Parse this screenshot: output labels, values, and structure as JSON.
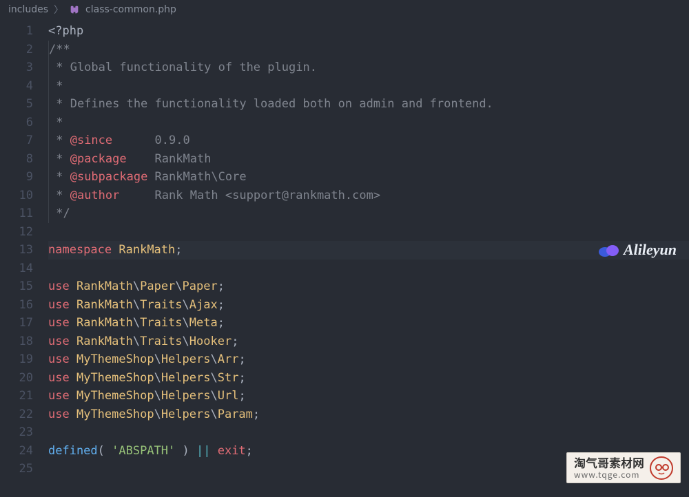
{
  "breadcrumb": {
    "folder": "includes",
    "file": "class-common.php"
  },
  "code": {
    "lines": [
      {
        "n": 1,
        "segs": [
          [
            "",
            "<?php",
            "t-php"
          ]
        ]
      },
      {
        "n": 2,
        "segs": [
          [
            "",
            "/**",
            "t-comment"
          ]
        ],
        "bl": true
      },
      {
        "n": 3,
        "segs": [
          [
            "",
            " * Global functionality of the plugin.",
            "t-comment"
          ]
        ],
        "bl": true
      },
      {
        "n": 4,
        "segs": [
          [
            "",
            " *",
            "t-comment"
          ]
        ],
        "bl": true
      },
      {
        "n": 5,
        "segs": [
          [
            "",
            " * Defines the functionality loaded both on admin and frontend.",
            "t-comment"
          ]
        ],
        "bl": true
      },
      {
        "n": 6,
        "segs": [
          [
            "",
            " *",
            "t-comment"
          ]
        ],
        "bl": true
      },
      {
        "n": 7,
        "segs": [
          [
            "",
            " * ",
            "t-comment"
          ],
          [
            "",
            "@since",
            "t-tag"
          ],
          [
            "",
            "      0.9.0",
            "t-comment"
          ]
        ],
        "bl": true
      },
      {
        "n": 8,
        "segs": [
          [
            "",
            " * ",
            "t-comment"
          ],
          [
            "",
            "@package",
            "t-tag"
          ],
          [
            "",
            "    RankMath",
            "t-comment"
          ]
        ],
        "bl": true
      },
      {
        "n": 9,
        "segs": [
          [
            "",
            " * ",
            "t-comment"
          ],
          [
            "",
            "@subpackage",
            "t-tag"
          ],
          [
            "",
            " RankMath\\Core",
            "t-comment"
          ]
        ],
        "bl": true
      },
      {
        "n": 10,
        "segs": [
          [
            "",
            " * ",
            "t-comment"
          ],
          [
            "",
            "@author",
            "t-tag"
          ],
          [
            "",
            "     Rank Math <support@rankmath.com>",
            "t-comment"
          ]
        ],
        "bl": true
      },
      {
        "n": 11,
        "segs": [
          [
            "",
            " */",
            "t-comment"
          ]
        ],
        "bl": true
      },
      {
        "n": 12,
        "segs": [
          [
            "",
            "",
            ""
          ]
        ]
      },
      {
        "n": 13,
        "hl": true,
        "segs": [
          [
            "",
            "namespace",
            "t-red"
          ],
          [
            "",
            " ",
            ""
          ],
          [
            "",
            "RankMath",
            "t-ns"
          ],
          [
            "",
            ";",
            "t-punct"
          ]
        ]
      },
      {
        "n": 14,
        "segs": [
          [
            "",
            "",
            ""
          ]
        ]
      },
      {
        "n": 15,
        "segs": [
          [
            "",
            "use",
            "t-red"
          ],
          [
            "",
            " ",
            ""
          ],
          [
            "",
            "RankMath",
            "t-ns"
          ],
          [
            "",
            "\\",
            "t-punct"
          ],
          [
            "",
            "Paper",
            "t-ns"
          ],
          [
            "",
            "\\",
            "t-punct"
          ],
          [
            "",
            "Paper",
            "t-ns"
          ],
          [
            "",
            ";",
            "t-punct"
          ]
        ]
      },
      {
        "n": 16,
        "segs": [
          [
            "",
            "use",
            "t-red"
          ],
          [
            "",
            " ",
            ""
          ],
          [
            "",
            "RankMath",
            "t-ns"
          ],
          [
            "",
            "\\",
            "t-punct"
          ],
          [
            "",
            "Traits",
            "t-ns"
          ],
          [
            "",
            "\\",
            "t-punct"
          ],
          [
            "",
            "Ajax",
            "t-ns"
          ],
          [
            "",
            ";",
            "t-punct"
          ]
        ]
      },
      {
        "n": 17,
        "segs": [
          [
            "",
            "use",
            "t-red"
          ],
          [
            "",
            " ",
            ""
          ],
          [
            "",
            "RankMath",
            "t-ns"
          ],
          [
            "",
            "\\",
            "t-punct"
          ],
          [
            "",
            "Traits",
            "t-ns"
          ],
          [
            "",
            "\\",
            "t-punct"
          ],
          [
            "",
            "Meta",
            "t-ns"
          ],
          [
            "",
            ";",
            "t-punct"
          ]
        ]
      },
      {
        "n": 18,
        "segs": [
          [
            "",
            "use",
            "t-red"
          ],
          [
            "",
            " ",
            ""
          ],
          [
            "",
            "RankMath",
            "t-ns"
          ],
          [
            "",
            "\\",
            "t-punct"
          ],
          [
            "",
            "Traits",
            "t-ns"
          ],
          [
            "",
            "\\",
            "t-punct"
          ],
          [
            "",
            "Hooker",
            "t-ns"
          ],
          [
            "",
            ";",
            "t-punct"
          ]
        ]
      },
      {
        "n": 19,
        "segs": [
          [
            "",
            "use",
            "t-red"
          ],
          [
            "",
            " ",
            ""
          ],
          [
            "",
            "MyThemeShop",
            "t-ns"
          ],
          [
            "",
            "\\",
            "t-punct"
          ],
          [
            "",
            "Helpers",
            "t-ns"
          ],
          [
            "",
            "\\",
            "t-punct"
          ],
          [
            "",
            "Arr",
            "t-ns"
          ],
          [
            "",
            ";",
            "t-punct"
          ]
        ]
      },
      {
        "n": 20,
        "segs": [
          [
            "",
            "use",
            "t-red"
          ],
          [
            "",
            " ",
            ""
          ],
          [
            "",
            "MyThemeShop",
            "t-ns"
          ],
          [
            "",
            "\\",
            "t-punct"
          ],
          [
            "",
            "Helpers",
            "t-ns"
          ],
          [
            "",
            "\\",
            "t-punct"
          ],
          [
            "",
            "Str",
            "t-ns"
          ],
          [
            "",
            ";",
            "t-punct"
          ]
        ]
      },
      {
        "n": 21,
        "segs": [
          [
            "",
            "use",
            "t-red"
          ],
          [
            "",
            " ",
            ""
          ],
          [
            "",
            "MyThemeShop",
            "t-ns"
          ],
          [
            "",
            "\\",
            "t-punct"
          ],
          [
            "",
            "Helpers",
            "t-ns"
          ],
          [
            "",
            "\\",
            "t-punct"
          ],
          [
            "",
            "Url",
            "t-ns"
          ],
          [
            "",
            ";",
            "t-punct"
          ]
        ]
      },
      {
        "n": 22,
        "segs": [
          [
            "",
            "use",
            "t-red"
          ],
          [
            "",
            " ",
            ""
          ],
          [
            "",
            "MyThemeShop",
            "t-ns"
          ],
          [
            "",
            "\\",
            "t-punct"
          ],
          [
            "",
            "Helpers",
            "t-ns"
          ],
          [
            "",
            "\\",
            "t-punct"
          ],
          [
            "",
            "Param",
            "t-ns"
          ],
          [
            "",
            ";",
            "t-punct"
          ]
        ]
      },
      {
        "n": 23,
        "segs": [
          [
            "",
            "",
            ""
          ]
        ]
      },
      {
        "n": 24,
        "segs": [
          [
            "",
            "defined",
            "t-fn"
          ],
          [
            "",
            "( ",
            "t-punct"
          ],
          [
            "",
            "'ABSPATH'",
            "t-str"
          ],
          [
            "",
            " ) ",
            "t-punct"
          ],
          [
            "",
            "||",
            "t-op"
          ],
          [
            "",
            " ",
            ""
          ],
          [
            "",
            "exit",
            "t-red"
          ],
          [
            "",
            ";",
            "t-punct"
          ]
        ]
      },
      {
        "n": 25,
        "segs": [
          [
            "",
            "",
            ""
          ]
        ]
      }
    ]
  },
  "watermarks": {
    "wm1_text": "Alileyun",
    "wm2_cn": "淘气哥素材网",
    "wm2_url": "www.tqge.com"
  }
}
